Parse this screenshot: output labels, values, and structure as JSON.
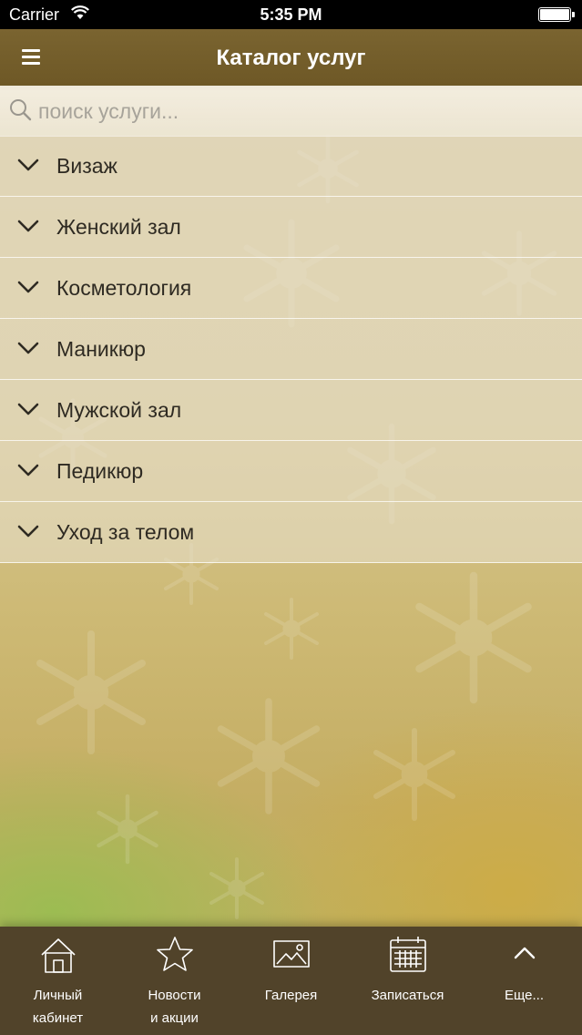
{
  "status_bar": {
    "carrier": "Carrier",
    "time": "5:35 PM"
  },
  "nav": {
    "title": "Каталог услуг",
    "menu_icon": "hamburger-menu-icon"
  },
  "search": {
    "placeholder": "поиск услуги..."
  },
  "categories": [
    {
      "label": "Визаж"
    },
    {
      "label": "Женский зал"
    },
    {
      "label": "Косметология"
    },
    {
      "label": "Маникюр"
    },
    {
      "label": "Мужской зал"
    },
    {
      "label": "Педикюр"
    },
    {
      "label": "Уход за телом"
    }
  ],
  "tabs": [
    {
      "line1": "Личный",
      "line2": "кабинет",
      "icon": "home-icon"
    },
    {
      "line1": "Новости",
      "line2": "и акции",
      "icon": "star-icon"
    },
    {
      "line1": "Галерея",
      "line2": "",
      "icon": "gallery-icon"
    },
    {
      "line1": "Записаться",
      "line2": "",
      "icon": "calendar-icon"
    },
    {
      "line1": "Еще...",
      "line2": "",
      "icon": "chevron-up-icon"
    }
  ],
  "colors": {
    "navbar": "#6e5826",
    "tabbar": "#51432a",
    "text": "#2e2a22"
  }
}
